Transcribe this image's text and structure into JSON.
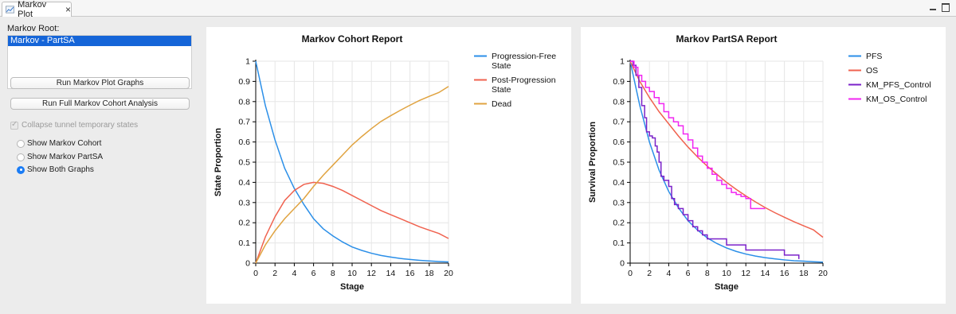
{
  "tab": {
    "label": "Markov Plot",
    "icon": "line-chart-icon",
    "close": "×"
  },
  "left_panel": {
    "root_label": "Markov Root:",
    "root_items": [
      "Markov - PartSA"
    ],
    "buttons": {
      "run_graphs": "Run Markov Plot Graphs",
      "run_full": "Run Full Markov Cohort Analysis"
    },
    "collapse_checkbox": {
      "label": "Collapse tunnel temporary states",
      "checked": true,
      "enabled": false
    },
    "radio_options": [
      {
        "label": "Show Markov Cohort",
        "selected": false
      },
      {
        "label": "Show Markov PartSA",
        "selected": false
      },
      {
        "label": "Show Both Graphs",
        "selected": true
      }
    ]
  },
  "colors": {
    "accent": "#1a7cf5",
    "selection": "#1565d8"
  },
  "chart_data": [
    {
      "type": "line",
      "title": "Markov Cohort Report",
      "xlabel": "Stage",
      "ylabel": "State Proportion",
      "xlim": [
        0,
        20
      ],
      "ylim": [
        0,
        1
      ],
      "xticks": [
        "0",
        "2",
        "4",
        "6",
        "8",
        "10",
        "12",
        "14",
        "16",
        "18",
        "20"
      ],
      "yticks": [
        "0",
        "0.1",
        "0.2",
        "0.3",
        "0.4",
        "0.5",
        "0.6",
        "0.7",
        "0.8",
        "0.9",
        "1"
      ],
      "grid": true,
      "legend_position": "right",
      "x": [
        0,
        1,
        2,
        3,
        4,
        5,
        6,
        7,
        8,
        9,
        10,
        11,
        12,
        13,
        14,
        15,
        16,
        17,
        18,
        19,
        20
      ],
      "series": [
        {
          "name": "Progression-Free State",
          "color": "#2b8fe8",
          "values": [
            1,
            0.78,
            0.61,
            0.47,
            0.37,
            0.29,
            0.22,
            0.17,
            0.135,
            0.105,
            0.08,
            0.063,
            0.049,
            0.038,
            0.03,
            0.023,
            0.018,
            0.014,
            0.011,
            0.008,
            0.006
          ]
        },
        {
          "name": "Post-Progression State",
          "color": "#f0624f",
          "values": [
            0,
            0.13,
            0.23,
            0.31,
            0.36,
            0.39,
            0.4,
            0.395,
            0.38,
            0.36,
            0.335,
            0.31,
            0.285,
            0.26,
            0.24,
            0.22,
            0.2,
            0.18,
            0.163,
            0.147,
            0.122
          ]
        },
        {
          "name": "Dead",
          "color": "#e0a340",
          "values": [
            0,
            0.09,
            0.16,
            0.22,
            0.27,
            0.32,
            0.38,
            0.435,
            0.485,
            0.535,
            0.585,
            0.627,
            0.666,
            0.702,
            0.73,
            0.757,
            0.782,
            0.806,
            0.826,
            0.845,
            0.875
          ]
        }
      ]
    },
    {
      "type": "line",
      "title": "Markov PartSA Report",
      "xlabel": "Stage",
      "ylabel": "Survival Proportion",
      "xlim": [
        0,
        20
      ],
      "ylim": [
        0,
        1
      ],
      "xticks": [
        "0",
        "2",
        "4",
        "6",
        "8",
        "10",
        "12",
        "14",
        "16",
        "18",
        "20"
      ],
      "yticks": [
        "0",
        "0.1",
        "0.2",
        "0.3",
        "0.4",
        "0.5",
        "0.6",
        "0.7",
        "0.8",
        "0.9",
        "1"
      ],
      "grid": true,
      "legend_position": "right",
      "series": [
        {
          "name": "PFS",
          "color": "#2b8fe8",
          "step": false,
          "points": [
            [
              0,
              1
            ],
            [
              1,
              0.78
            ],
            [
              2,
              0.6
            ],
            [
              3,
              0.46
            ],
            [
              4,
              0.355
            ],
            [
              5,
              0.275
            ],
            [
              6,
              0.21
            ],
            [
              7,
              0.163
            ],
            [
              8,
              0.125
            ],
            [
              9,
              0.097
            ],
            [
              10,
              0.075
            ],
            [
              11,
              0.058
            ],
            [
              12,
              0.045
            ],
            [
              13,
              0.035
            ],
            [
              14,
              0.027
            ],
            [
              15,
              0.021
            ],
            [
              16,
              0.016
            ],
            [
              17,
              0.012
            ],
            [
              18,
              0.01
            ],
            [
              19,
              0.007
            ],
            [
              20,
              0.005
            ]
          ]
        },
        {
          "name": "OS",
          "color": "#f0624f",
          "step": false,
          "points": [
            [
              0,
              1
            ],
            [
              1,
              0.9
            ],
            [
              2,
              0.82
            ],
            [
              3,
              0.75
            ],
            [
              4,
              0.69
            ],
            [
              5,
              0.63
            ],
            [
              6,
              0.575
            ],
            [
              7,
              0.525
            ],
            [
              8,
              0.48
            ],
            [
              9,
              0.44
            ],
            [
              10,
              0.4
            ],
            [
              11,
              0.365
            ],
            [
              12,
              0.333
            ],
            [
              13,
              0.303
            ],
            [
              14,
              0.275
            ],
            [
              15,
              0.25
            ],
            [
              16,
              0.227
            ],
            [
              17,
              0.205
            ],
            [
              18,
              0.185
            ],
            [
              19,
              0.165
            ],
            [
              20,
              0.128
            ]
          ]
        },
        {
          "name": "KM_PFS_Control",
          "color": "#7b22c9",
          "step": true,
          "points": [
            [
              0,
              1
            ],
            [
              0.3,
              0.98
            ],
            [
              0.6,
              0.93
            ],
            [
              0.9,
              0.87
            ],
            [
              1.2,
              0.78
            ],
            [
              1.5,
              0.72
            ],
            [
              1.7,
              0.65
            ],
            [
              2.0,
              0.63
            ],
            [
              2.3,
              0.62
            ],
            [
              2.6,
              0.58
            ],
            [
              2.8,
              0.55
            ],
            [
              3.0,
              0.5
            ],
            [
              3.2,
              0.43
            ],
            [
              3.5,
              0.41
            ],
            [
              4.0,
              0.38
            ],
            [
              4.3,
              0.32
            ],
            [
              4.6,
              0.29
            ],
            [
              5.0,
              0.27
            ],
            [
              5.5,
              0.24
            ],
            [
              6.0,
              0.21
            ],
            [
              6.5,
              0.18
            ],
            [
              7.0,
              0.16
            ],
            [
              7.5,
              0.14
            ],
            [
              8.0,
              0.12
            ],
            [
              10.0,
              0.09
            ],
            [
              12.0,
              0.065
            ],
            [
              16.0,
              0.04
            ],
            [
              17.5,
              0.02
            ],
            [
              17.5,
              0.02
            ]
          ]
        },
        {
          "name": "KM_OS_Control",
          "color": "#f126f1",
          "step": true,
          "points": [
            [
              0,
              1
            ],
            [
              0.4,
              0.97
            ],
            [
              0.8,
              0.93
            ],
            [
              1.2,
              0.9
            ],
            [
              1.6,
              0.87
            ],
            [
              2.0,
              0.85
            ],
            [
              2.5,
              0.82
            ],
            [
              3.0,
              0.79
            ],
            [
              3.5,
              0.75
            ],
            [
              4.0,
              0.72
            ],
            [
              4.5,
              0.7
            ],
            [
              5.0,
              0.68
            ],
            [
              5.5,
              0.64
            ],
            [
              6.0,
              0.61
            ],
            [
              6.5,
              0.57
            ],
            [
              7.0,
              0.53
            ],
            [
              7.5,
              0.5
            ],
            [
              8.0,
              0.47
            ],
            [
              8.5,
              0.44
            ],
            [
              9.0,
              0.41
            ],
            [
              9.5,
              0.39
            ],
            [
              10.0,
              0.37
            ],
            [
              10.5,
              0.35
            ],
            [
              11.0,
              0.34
            ],
            [
              11.5,
              0.33
            ],
            [
              12.0,
              0.32
            ],
            [
              12.5,
              0.27
            ],
            [
              14.0,
              0.27
            ]
          ]
        }
      ]
    }
  ]
}
